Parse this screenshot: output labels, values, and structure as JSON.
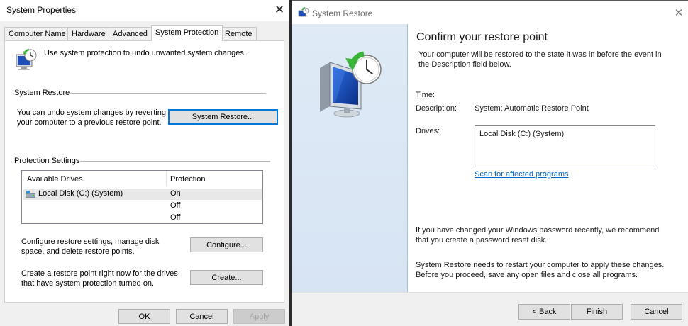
{
  "system_properties": {
    "title": "System Properties",
    "close_glyph": "✕",
    "tabs": [
      {
        "label": "Computer Name"
      },
      {
        "label": "Hardware"
      },
      {
        "label": "Advanced"
      },
      {
        "label": "System Protection"
      },
      {
        "label": "Remote"
      }
    ],
    "active_tab": "System Protection",
    "intro_text": "Use system protection to undo unwanted system changes.",
    "system_restore": {
      "group_title": "System Restore",
      "description": "You can undo system changes by reverting your computer to a previous restore point.",
      "button_label": "System Restore..."
    },
    "protection_settings": {
      "group_title": "Protection Settings",
      "columns": [
        "Available Drives",
        "Protection"
      ],
      "rows": [
        {
          "drive": "Local Disk (C:) (System)",
          "protection": "On"
        },
        {
          "drive": "",
          "protection": "Off"
        },
        {
          "drive": "",
          "protection": "Off"
        }
      ],
      "configure_text": "Configure restore settings, manage disk space, and delete restore points.",
      "configure_button": "Configure...",
      "create_text": "Create a restore point right now for the drives that have system protection turned on.",
      "create_button": "Create..."
    },
    "footer": {
      "ok": "OK",
      "cancel": "Cancel",
      "apply": "Apply"
    }
  },
  "system_restore_wizard": {
    "title": "System Restore",
    "close_glyph": "✕",
    "heading": "Confirm your restore point",
    "subtitle": "Your computer will be restored to the state it was in before the event in the Description field below.",
    "time_label": "Time:",
    "time_value": "",
    "description_label": "Description:",
    "description_value": "System: Automatic Restore Point",
    "drives_label": "Drives:",
    "drives_value": "Local Disk (C:) (System)",
    "scan_link": "Scan for affected programs",
    "password_note": "If you have changed your Windows password recently, we recommend that you create a password reset disk.",
    "restart_note": "System Restore needs to restart your computer to apply these changes. Before you proceed, save any open files and close all programs.",
    "buttons": {
      "back": "< Back",
      "finish": "Finish",
      "cancel": "Cancel"
    }
  },
  "icons": {
    "system_protection": "system-restore-monitor-icon",
    "drive": "hard-drive-icon",
    "wizard_logo": "system-restore-logo-icon",
    "wizard_large": "monitor-with-clock-icon"
  },
  "colors": {
    "accent": "#0078d7",
    "link": "#0066cc",
    "dialog_bg": "#f0f0f0",
    "wizard_side": "#dfeaf6"
  }
}
